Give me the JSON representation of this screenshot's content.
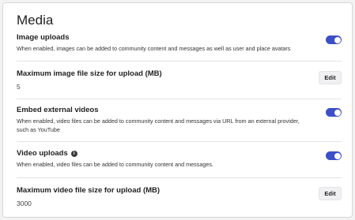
{
  "section": {
    "title": "Media"
  },
  "settings": [
    {
      "title": "Image uploads",
      "description": "When enabled, images can be added to community content and messages as well as user and place avatars",
      "toggle_on": true
    },
    {
      "title": "Maximum image file size for upload (MB)",
      "value": "5",
      "button_label": "Edit"
    },
    {
      "title": "Embed external videos",
      "description": "When enabled, video files can be added to community content and messages via URL from an external provider, such as YouTube",
      "toggle_on": true
    },
    {
      "title": "Video uploads",
      "info_icon": "i",
      "description": "When enabled, video files can be added to community content and messages.",
      "toggle_on": true
    },
    {
      "title": "Maximum video file size for upload (MB)",
      "value": "3000",
      "button_label": "Edit"
    }
  ],
  "colors": {
    "toggle_on": "#3d4fc7",
    "divider": "#e3e3e6"
  }
}
